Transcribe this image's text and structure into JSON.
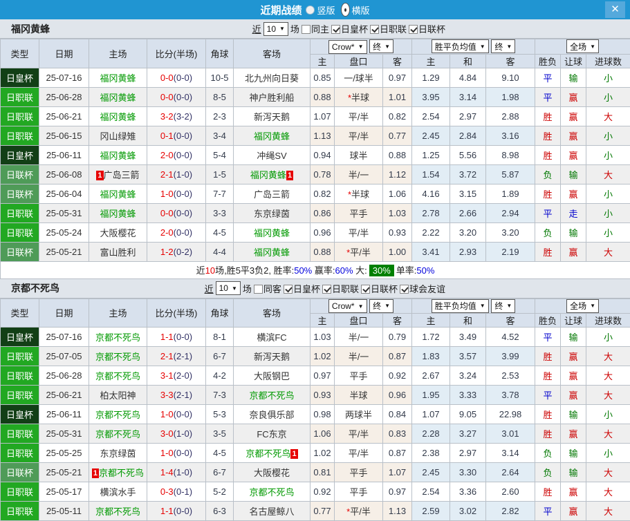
{
  "titlebar": {
    "title": "近期战绩",
    "radios": [
      {
        "label": "竖版",
        "selected": false
      },
      {
        "label": "横版",
        "selected": true
      }
    ],
    "close": "✕"
  },
  "colors": {
    "league": {
      "日皇杯": "#123f16",
      "日职联": "#22a822",
      "日联杯": "#4f9b58"
    },
    "focal_team": "#009900",
    "titlebar_blue": "#2095d2"
  },
  "table_headers": {
    "left": [
      "类型",
      "日期",
      "主场",
      "比分(半场)",
      "角球",
      "客场"
    ],
    "right": [
      "主",
      "盘口",
      "客",
      "主",
      "和",
      "客",
      "胜负",
      "让球",
      "进球数"
    ]
  },
  "outcome_colors": {
    "胜": "red",
    "赢": "red",
    "大": "red",
    "平": "blue",
    "走": "blue",
    "负": "green",
    "输": "green",
    "小": "green"
  },
  "sections": [
    {
      "team": "福冈黄蜂",
      "controls": {
        "near": "近",
        "count": "10",
        "games": "场",
        "same": {
          "label": "同主",
          "checked": false
        },
        "cups": [
          {
            "label": "日皇杯",
            "checked": true
          },
          {
            "label": "日职联",
            "checked": true
          },
          {
            "label": "日联杯",
            "checked": true
          }
        ]
      },
      "dropdowns": {
        "company": "Crow*",
        "final1": "终",
        "avg": "胜平负均值",
        "final2": "终",
        "scope": "全场"
      },
      "rows": [
        {
          "type": "日皇杯",
          "date": "25-07-16",
          "home": "福冈黄蜂",
          "home_focal": true,
          "home_badge": "",
          "score": "0-0",
          "half": "(0-0)",
          "corners": "10-5",
          "away": "北九州向日葵",
          "away_focal": false,
          "away_badge": "",
          "home_odds": "0.85",
          "handicap": "一/球半",
          "handicap_star": false,
          "away_odds": "0.97",
          "avg_win": "1.29",
          "avg_draw": "4.84",
          "avg_lose": "9.10",
          "outcome": "平",
          "handicap_outcome": "输",
          "goals": "小"
        },
        {
          "type": "日职联",
          "date": "25-06-28",
          "home": "福冈黄蜂",
          "home_focal": true,
          "home_badge": "",
          "score": "0-0",
          "half": "(0-0)",
          "corners": "8-5",
          "away": "神户胜利船",
          "away_focal": false,
          "away_badge": "",
          "home_odds": "0.88",
          "handicap": "半球",
          "handicap_star": true,
          "away_odds": "1.01",
          "avg_win": "3.95",
          "avg_draw": "3.14",
          "avg_lose": "1.98",
          "outcome": "平",
          "handicap_outcome": "赢",
          "goals": "小"
        },
        {
          "type": "日职联",
          "date": "25-06-21",
          "home": "福冈黄蜂",
          "home_focal": true,
          "home_badge": "",
          "score": "3-2",
          "half": "(3-2)",
          "corners": "2-3",
          "away": "新泻天鹅",
          "away_focal": false,
          "away_badge": "",
          "home_odds": "1.07",
          "handicap": "平/半",
          "handicap_star": false,
          "away_odds": "0.82",
          "avg_win": "2.54",
          "avg_draw": "2.97",
          "avg_lose": "2.88",
          "outcome": "胜",
          "handicap_outcome": "赢",
          "goals": "大"
        },
        {
          "type": "日职联",
          "date": "25-06-15",
          "home": "冈山绿雉",
          "home_focal": false,
          "home_badge": "",
          "score": "0-1",
          "half": "(0-0)",
          "corners": "3-4",
          "away": "福冈黄蜂",
          "away_focal": true,
          "away_badge": "",
          "home_odds": "1.13",
          "handicap": "平/半",
          "handicap_star": false,
          "away_odds": "0.77",
          "avg_win": "2.45",
          "avg_draw": "2.84",
          "avg_lose": "3.16",
          "outcome": "胜",
          "handicap_outcome": "赢",
          "goals": "小"
        },
        {
          "type": "日皇杯",
          "date": "25-06-11",
          "home": "福冈黄蜂",
          "home_focal": true,
          "home_badge": "",
          "score": "2-0",
          "half": "(0-0)",
          "corners": "5-4",
          "away": "冲绳SV",
          "away_focal": false,
          "away_badge": "",
          "home_odds": "0.94",
          "handicap": "球半",
          "handicap_star": false,
          "away_odds": "0.88",
          "avg_win": "1.25",
          "avg_draw": "5.56",
          "avg_lose": "8.98",
          "outcome": "胜",
          "handicap_outcome": "赢",
          "goals": "小"
        },
        {
          "type": "日联杯",
          "date": "25-06-08",
          "home": "广岛三箭",
          "home_focal": false,
          "home_badge": "1",
          "score": "2-1",
          "half": "(1-0)",
          "corners": "1-5",
          "away": "福冈黄蜂",
          "away_focal": true,
          "away_badge": "1",
          "home_odds": "0.78",
          "handicap": "半/一",
          "handicap_star": false,
          "away_odds": "1.12",
          "avg_win": "1.54",
          "avg_draw": "3.72",
          "avg_lose": "5.87",
          "outcome": "负",
          "handicap_outcome": "输",
          "goals": "大"
        },
        {
          "type": "日联杯",
          "date": "25-06-04",
          "home": "福冈黄蜂",
          "home_focal": true,
          "home_badge": "",
          "score": "1-0",
          "half": "(0-0)",
          "corners": "7-7",
          "away": "广岛三箭",
          "away_focal": false,
          "away_badge": "",
          "home_odds": "0.82",
          "handicap": "半球",
          "handicap_star": true,
          "away_odds": "1.06",
          "avg_win": "4.16",
          "avg_draw": "3.15",
          "avg_lose": "1.89",
          "outcome": "胜",
          "handicap_outcome": "赢",
          "goals": "小"
        },
        {
          "type": "日职联",
          "date": "25-05-31",
          "home": "福冈黄蜂",
          "home_focal": true,
          "home_badge": "",
          "score": "0-0",
          "half": "(0-0)",
          "corners": "3-3",
          "away": "东京绿茵",
          "away_focal": false,
          "away_badge": "",
          "home_odds": "0.86",
          "handicap": "平手",
          "handicap_star": false,
          "away_odds": "1.03",
          "avg_win": "2.78",
          "avg_draw": "2.66",
          "avg_lose": "2.94",
          "outcome": "平",
          "handicap_outcome": "走",
          "goals": "小"
        },
        {
          "type": "日职联",
          "date": "25-05-24",
          "home": "大阪樱花",
          "home_focal": false,
          "home_badge": "",
          "score": "2-0",
          "half": "(0-0)",
          "corners": "4-5",
          "away": "福冈黄蜂",
          "away_focal": true,
          "away_badge": "",
          "home_odds": "0.96",
          "handicap": "平/半",
          "handicap_star": false,
          "away_odds": "0.93",
          "avg_win": "2.22",
          "avg_draw": "3.20",
          "avg_lose": "3.20",
          "outcome": "负",
          "handicap_outcome": "输",
          "goals": "小"
        },
        {
          "type": "日联杯",
          "date": "25-05-21",
          "home": "富山胜利",
          "home_focal": false,
          "home_badge": "",
          "score": "1-2",
          "half": "(0-2)",
          "corners": "4-4",
          "away": "福冈黄蜂",
          "away_focal": true,
          "away_badge": "",
          "home_odds": "0.88",
          "handicap": "平/半",
          "handicap_star": true,
          "away_odds": "1.00",
          "avg_win": "3.41",
          "avg_draw": "2.93",
          "avg_lose": "2.19",
          "outcome": "胜",
          "handicap_outcome": "赢",
          "goals": "大"
        }
      ],
      "summary": {
        "near": "近",
        "count": "10",
        "mid": "场,胜5平3负2, 胜率:",
        "win_rate": "50%",
        "profit_label": " 赢率:",
        "profit_rate": "60%",
        "big_label": " 大:",
        "big_rate": "30%",
        "single_label": "单率:",
        "single_rate": "50%"
      }
    },
    {
      "team": "京都不死鸟",
      "controls": {
        "near": "近",
        "count": "10",
        "games": "场",
        "same": {
          "label": "同客",
          "checked": false
        },
        "cups": [
          {
            "label": "日皇杯",
            "checked": true
          },
          {
            "label": "日职联",
            "checked": true
          },
          {
            "label": "日联杯",
            "checked": true
          },
          {
            "label": "球会友谊",
            "checked": true
          }
        ]
      },
      "dropdowns": {
        "company": "Crow*",
        "final1": "终",
        "avg": "胜平负均值",
        "final2": "终",
        "scope": "全场"
      },
      "rows": [
        {
          "type": "日皇杯",
          "date": "25-07-16",
          "home": "京都不死鸟",
          "home_focal": true,
          "home_badge": "",
          "score": "1-1",
          "half": "(0-0)",
          "corners": "8-1",
          "away": "横滨FC",
          "away_focal": false,
          "away_badge": "",
          "home_odds": "1.03",
          "handicap": "半/一",
          "handicap_star": false,
          "away_odds": "0.79",
          "avg_win": "1.72",
          "avg_draw": "3.49",
          "avg_lose": "4.52",
          "outcome": "平",
          "handicap_outcome": "输",
          "goals": "小"
        },
        {
          "type": "日职联",
          "date": "25-07-05",
          "home": "京都不死鸟",
          "home_focal": true,
          "home_badge": "",
          "score": "2-1",
          "half": "(2-1)",
          "corners": "6-7",
          "away": "新泻天鹅",
          "away_focal": false,
          "away_badge": "",
          "home_odds": "1.02",
          "handicap": "半/一",
          "handicap_star": false,
          "away_odds": "0.87",
          "avg_win": "1.83",
          "avg_draw": "3.57",
          "avg_lose": "3.99",
          "outcome": "胜",
          "handicap_outcome": "赢",
          "goals": "大"
        },
        {
          "type": "日职联",
          "date": "25-06-28",
          "home": "京都不死鸟",
          "home_focal": true,
          "home_badge": "",
          "score": "3-1",
          "half": "(2-0)",
          "corners": "4-2",
          "away": "大阪钢巴",
          "away_focal": false,
          "away_badge": "",
          "home_odds": "0.97",
          "handicap": "平手",
          "handicap_star": false,
          "away_odds": "0.92",
          "avg_win": "2.67",
          "avg_draw": "3.24",
          "avg_lose": "2.53",
          "outcome": "胜",
          "handicap_outcome": "赢",
          "goals": "大"
        },
        {
          "type": "日职联",
          "date": "25-06-21",
          "home": "柏太阳神",
          "home_focal": false,
          "home_badge": "",
          "score": "3-3",
          "half": "(2-1)",
          "corners": "7-3",
          "away": "京都不死鸟",
          "away_focal": true,
          "away_badge": "",
          "home_odds": "0.93",
          "handicap": "半球",
          "handicap_star": false,
          "away_odds": "0.96",
          "avg_win": "1.95",
          "avg_draw": "3.33",
          "avg_lose": "3.78",
          "outcome": "平",
          "handicap_outcome": "赢",
          "goals": "大"
        },
        {
          "type": "日皇杯",
          "date": "25-06-11",
          "home": "京都不死鸟",
          "home_focal": true,
          "home_badge": "",
          "score": "1-0",
          "half": "(0-0)",
          "corners": "5-3",
          "away": "奈良俱乐部",
          "away_focal": false,
          "away_badge": "",
          "home_odds": "0.98",
          "handicap": "两球半",
          "handicap_star": false,
          "away_odds": "0.84",
          "avg_win": "1.07",
          "avg_draw": "9.05",
          "avg_lose": "22.98",
          "outcome": "胜",
          "handicap_outcome": "输",
          "goals": "小"
        },
        {
          "type": "日职联",
          "date": "25-05-31",
          "home": "京都不死鸟",
          "home_focal": true,
          "home_badge": "",
          "score": "3-0",
          "half": "(1-0)",
          "corners": "3-5",
          "away": "FC东京",
          "away_focal": false,
          "away_badge": "",
          "home_odds": "1.06",
          "handicap": "平/半",
          "handicap_star": false,
          "away_odds": "0.83",
          "avg_win": "2.28",
          "avg_draw": "3.27",
          "avg_lose": "3.01",
          "outcome": "胜",
          "handicap_outcome": "赢",
          "goals": "大"
        },
        {
          "type": "日职联",
          "date": "25-05-25",
          "home": "东京绿茵",
          "home_focal": false,
          "home_badge": "",
          "score": "1-0",
          "half": "(0-0)",
          "corners": "4-5",
          "away": "京都不死鸟",
          "away_focal": true,
          "away_badge": "1",
          "home_odds": "1.02",
          "handicap": "平/半",
          "handicap_star": false,
          "away_odds": "0.87",
          "avg_win": "2.38",
          "avg_draw": "2.97",
          "avg_lose": "3.14",
          "outcome": "负",
          "handicap_outcome": "输",
          "goals": "小"
        },
        {
          "type": "日联杯",
          "date": "25-05-21",
          "home": "京都不死鸟",
          "home_focal": true,
          "home_badge": "1",
          "score": "1-4",
          "half": "(1-0)",
          "corners": "6-7",
          "away": "大阪樱花",
          "away_focal": false,
          "away_badge": "",
          "home_odds": "0.81",
          "handicap": "平手",
          "handicap_star": false,
          "away_odds": "1.07",
          "avg_win": "2.45",
          "avg_draw": "3.30",
          "avg_lose": "2.64",
          "outcome": "负",
          "handicap_outcome": "输",
          "goals": "大"
        },
        {
          "type": "日职联",
          "date": "25-05-17",
          "home": "横滨水手",
          "home_focal": false,
          "home_badge": "",
          "score": "0-3",
          "half": "(0-1)",
          "corners": "5-2",
          "away": "京都不死鸟",
          "away_focal": true,
          "away_badge": "",
          "home_odds": "0.92",
          "handicap": "平手",
          "handicap_star": false,
          "away_odds": "0.97",
          "avg_win": "2.54",
          "avg_draw": "3.36",
          "avg_lose": "2.60",
          "outcome": "胜",
          "handicap_outcome": "赢",
          "goals": "大"
        },
        {
          "type": "日职联",
          "date": "25-05-11",
          "home": "京都不死鸟",
          "home_focal": true,
          "home_badge": "",
          "score": "1-1",
          "half": "(0-0)",
          "corners": "6-3",
          "away": "名古屋鲸八",
          "away_focal": false,
          "away_badge": "",
          "home_odds": "0.77",
          "handicap": "平/半",
          "handicap_star": true,
          "away_odds": "1.13",
          "avg_win": "2.59",
          "avg_draw": "3.02",
          "avg_lose": "2.82",
          "outcome": "平",
          "handicap_outcome": "赢",
          "goals": "大"
        }
      ],
      "summary": null
    }
  ]
}
